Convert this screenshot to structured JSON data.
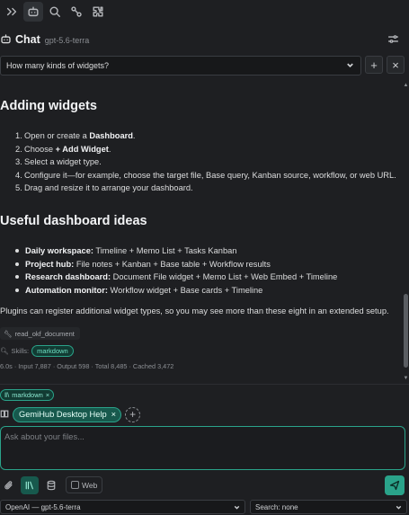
{
  "header": {
    "title": "Chat",
    "model": "gpt-5.6-terra"
  },
  "conversation": {
    "selected": "How many kinds of widgets?",
    "new_label": "+",
    "close_label": "×"
  },
  "message": {
    "section1_title": "Adding widgets",
    "steps": [
      {
        "num": "1.",
        "pre": "Open or create a ",
        "bold": "Dashboard",
        "post": "."
      },
      {
        "num": "2.",
        "pre": "Choose ",
        "bold": "+ Add Widget",
        "post": "."
      },
      {
        "num": "3.",
        "pre": "Select a widget type.",
        "bold": "",
        "post": ""
      },
      {
        "num": "4.",
        "pre": "Configure it—for example, choose the target file, Base query, Kanban source, workflow, or web URL.",
        "bold": "",
        "post": ""
      },
      {
        "num": "5.",
        "pre": "Drag and resize it to arrange your dashboard.",
        "bold": "",
        "post": ""
      }
    ],
    "section2_title": "Useful dashboard ideas",
    "ideas": [
      {
        "bold": "Daily workspace:",
        "text": " Timeline + Memo List + Tasks Kanban"
      },
      {
        "bold": "Project hub:",
        "text": " File notes + Kanban + Base table + Workflow results"
      },
      {
        "bold": "Research dashboard:",
        "text": " Document File widget + Memo List + Web Embed + Timeline"
      },
      {
        "bold": "Automation monitor:",
        "text": " Workflow widget + Base cards + Timeline"
      }
    ],
    "closing": "Plugins can register additional widget types, so you may see more than these eight in an extended setup.",
    "tool_call": "read_okf_document",
    "skills_label": "Skills:",
    "skill": "markdown",
    "stats": "6.0s · Input 7,887 · Output 598 · Total 8,485 · Cached 3,472"
  },
  "context": {
    "skill_chip": "markdown",
    "help_chip": "GemiHub Desktop Help",
    "remove": "×",
    "add": "+"
  },
  "input": {
    "placeholder": "Ask about your files..."
  },
  "toolbar": {
    "web_label": "Web"
  },
  "selects": {
    "model": "OpenAI — gpt-5.6-terra",
    "search": "Search: none"
  },
  "colors": {
    "accent": "#2aa38a",
    "background": "#1e1f22"
  }
}
